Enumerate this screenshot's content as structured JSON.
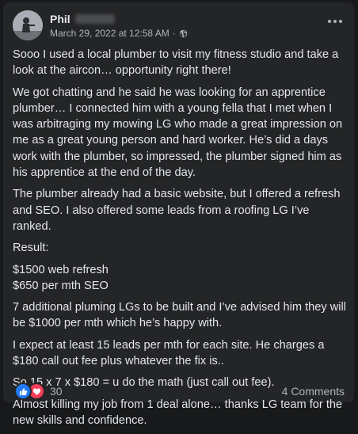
{
  "post": {
    "author_name": "Phil",
    "timestamp": "March 29, 2022 at 12:58 AM",
    "separator": "·",
    "privacy_icon": "globe-icon",
    "menu_icon": "more-options-icon",
    "paragraphs": [
      "Sooo I used a local plumber to visit my fitness studio and take a look at the aircon… opportunity right there!",
      "We got chatting and he said he was looking for an apprentice plumber… I connected him with a young fella that I met when I was arbitraging my mowing LG who made a great impression on me as a great young person and hard worker. He’s did a days work with the plumber, so impressed, the plumber signed him as his apprentice at the end of the day.",
      "The plumber already had a basic website, but I offered a refresh and SEO. I also offered some leads from a roofing LG I’ve ranked.",
      "Result:"
    ],
    "results": [
      "$1500 web refresh",
      "$650 per mth SEO"
    ],
    "paragraphs_after": [
      "7 additional pluming LGs to be built and I’ve advised him they will be $1000 per mth which he’s happy with.",
      "I expect at least 15 leads per mth for each site. He charges a $180 call out fee plus whatever the fix is..",
      "So 15 x 7 x $180 = u do the math (just call out fee).",
      "Almost killing my job from 1 deal alone… thanks LG team for the new skills and confidence."
    ]
  },
  "footer": {
    "reaction_icons": [
      "like-icon",
      "love-icon"
    ],
    "reaction_count": "30",
    "comments_label": "4 Comments"
  },
  "colors": {
    "page_background": "#18191a",
    "card_background": "#242526",
    "primary_text": "#e4e6eb",
    "secondary_text": "#b0b3b8",
    "like_blue": "#2078f4",
    "love_red": "#f33e58"
  }
}
